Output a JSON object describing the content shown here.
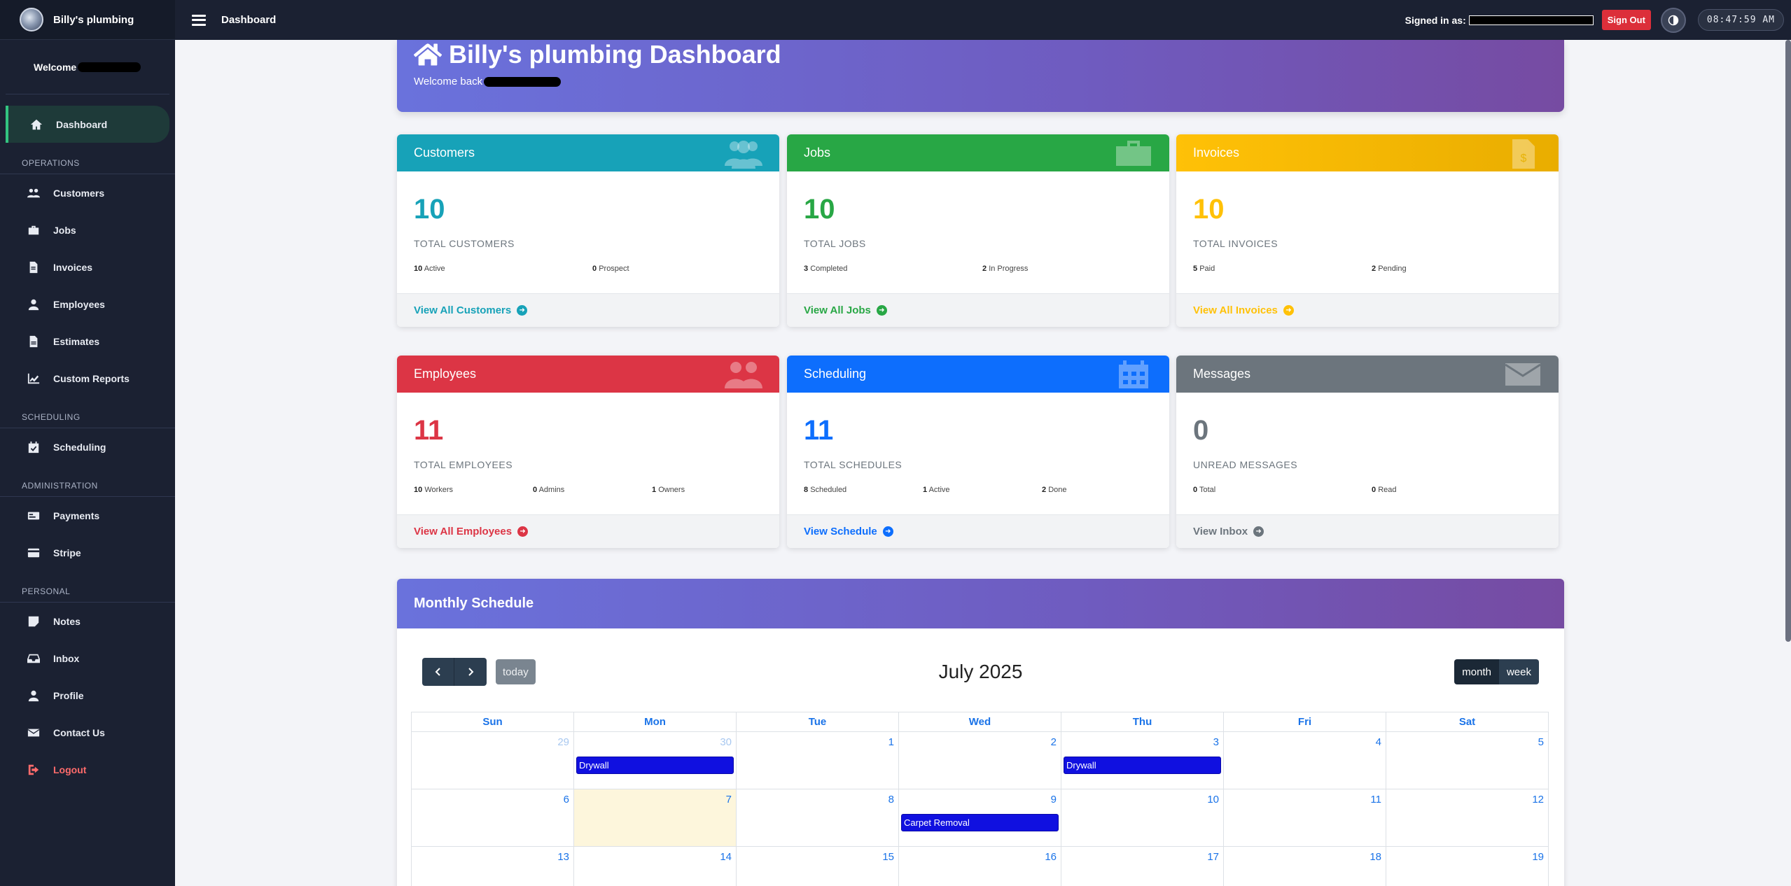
{
  "sidebar": {
    "brand": "Billy's plumbing",
    "welcome": "Welcome",
    "sections": [
      {
        "label": "",
        "items": [
          {
            "label": "Dashboard",
            "icon": "home-icon",
            "active": true
          }
        ]
      },
      {
        "label": "OPERATIONS",
        "items": [
          {
            "label": "Customers",
            "icon": "users-icon"
          },
          {
            "label": "Jobs",
            "icon": "briefcase-icon"
          },
          {
            "label": "Invoices",
            "icon": "invoice-icon"
          },
          {
            "label": "Employees",
            "icon": "user-icon"
          },
          {
            "label": "Estimates",
            "icon": "file-icon"
          },
          {
            "label": "Custom Reports",
            "icon": "chart-icon"
          }
        ]
      },
      {
        "label": "SCHEDULING",
        "items": [
          {
            "label": "Scheduling",
            "icon": "calendar-check-icon"
          }
        ]
      },
      {
        "label": "ADMINISTRATION",
        "items": [
          {
            "label": "Payments",
            "icon": "money-check-icon"
          },
          {
            "label": "Stripe",
            "icon": "credit-card-icon"
          }
        ]
      },
      {
        "label": "PERSONAL",
        "items": [
          {
            "label": "Notes",
            "icon": "sticky-note-icon"
          },
          {
            "label": "Inbox",
            "icon": "inbox-icon"
          },
          {
            "label": "Profile",
            "icon": "user-icon"
          },
          {
            "label": "Contact Us",
            "icon": "envelope-icon"
          },
          {
            "label": "Logout",
            "icon": "sign-out-icon",
            "danger": true
          }
        ]
      }
    ]
  },
  "topbar": {
    "title": "Dashboard",
    "signed_in_label": "Signed in as:",
    "signout_label": "Sign Out",
    "clock": "08:47:59 AM"
  },
  "hero": {
    "title": "Billy's plumbing Dashboard",
    "subtitle": "Welcome back"
  },
  "cards": [
    {
      "key": "customers",
      "title": "Customers",
      "color": "#17a2b8",
      "count": "10",
      "label": "TOTAL CUSTOMERS",
      "stats": [
        {
          "value": "10",
          "label": "Active"
        },
        {
          "value": "0",
          "label": "Prospect"
        }
      ],
      "link": "View All Customers"
    },
    {
      "key": "jobs",
      "title": "Jobs",
      "color": "#28a745",
      "count": "10",
      "label": "TOTAL JOBS",
      "stats": [
        {
          "value": "3",
          "label": "Completed"
        },
        {
          "value": "2",
          "label": "In Progress"
        }
      ],
      "link": "View All Jobs"
    },
    {
      "key": "invoices",
      "title": "Invoices",
      "color": "#ffc107",
      "count": "10",
      "label": "TOTAL INVOICES",
      "stats": [
        {
          "value": "5",
          "label": "Paid"
        },
        {
          "value": "2",
          "label": "Pending"
        }
      ],
      "link": "View All Invoices"
    },
    {
      "key": "employees",
      "title": "Employees",
      "color": "#dc3545",
      "count": "11",
      "label": "TOTAL EMPLOYEES",
      "stats": [
        {
          "value": "10",
          "label": "Workers"
        },
        {
          "value": "0",
          "label": "Admins"
        },
        {
          "value": "1",
          "label": "Owners"
        }
      ],
      "link": "View All Employees"
    },
    {
      "key": "scheduling",
      "title": "Scheduling",
      "color": "#0d6efd",
      "count": "11",
      "label": "TOTAL SCHEDULES",
      "stats": [
        {
          "value": "8",
          "label": "Scheduled"
        },
        {
          "value": "1",
          "label": "Active"
        },
        {
          "value": "2",
          "label": "Done"
        }
      ],
      "link": "View Schedule"
    },
    {
      "key": "messages",
      "title": "Messages",
      "color": "#6c757d",
      "count": "0",
      "label": "UNREAD MESSAGES",
      "stats": [
        {
          "value": "0",
          "label": "Total"
        },
        {
          "value": "0",
          "label": "Read"
        }
      ],
      "link": "View Inbox"
    }
  ],
  "calendar": {
    "heading": "Monthly Schedule",
    "title": "July 2025",
    "today_label": "today",
    "views": [
      "month",
      "week"
    ],
    "days_of_week": [
      "Sun",
      "Mon",
      "Tue",
      "Wed",
      "Thu",
      "Fri",
      "Sat"
    ],
    "weeks": [
      [
        {
          "n": "29",
          "other": true
        },
        {
          "n": "30",
          "other": true,
          "event": "Drywall"
        },
        {
          "n": "1"
        },
        {
          "n": "2"
        },
        {
          "n": "3",
          "event": "Drywall"
        },
        {
          "n": "4"
        },
        {
          "n": "5"
        }
      ],
      [
        {
          "n": "6"
        },
        {
          "n": "7",
          "today": true
        },
        {
          "n": "8"
        },
        {
          "n": "9",
          "event": "Carpet Removal"
        },
        {
          "n": "10"
        },
        {
          "n": "11"
        },
        {
          "n": "12"
        }
      ],
      [
        {
          "n": "13"
        },
        {
          "n": "14"
        },
        {
          "n": "15"
        },
        {
          "n": "16"
        },
        {
          "n": "17"
        },
        {
          "n": "18"
        },
        {
          "n": "19"
        }
      ]
    ]
  }
}
